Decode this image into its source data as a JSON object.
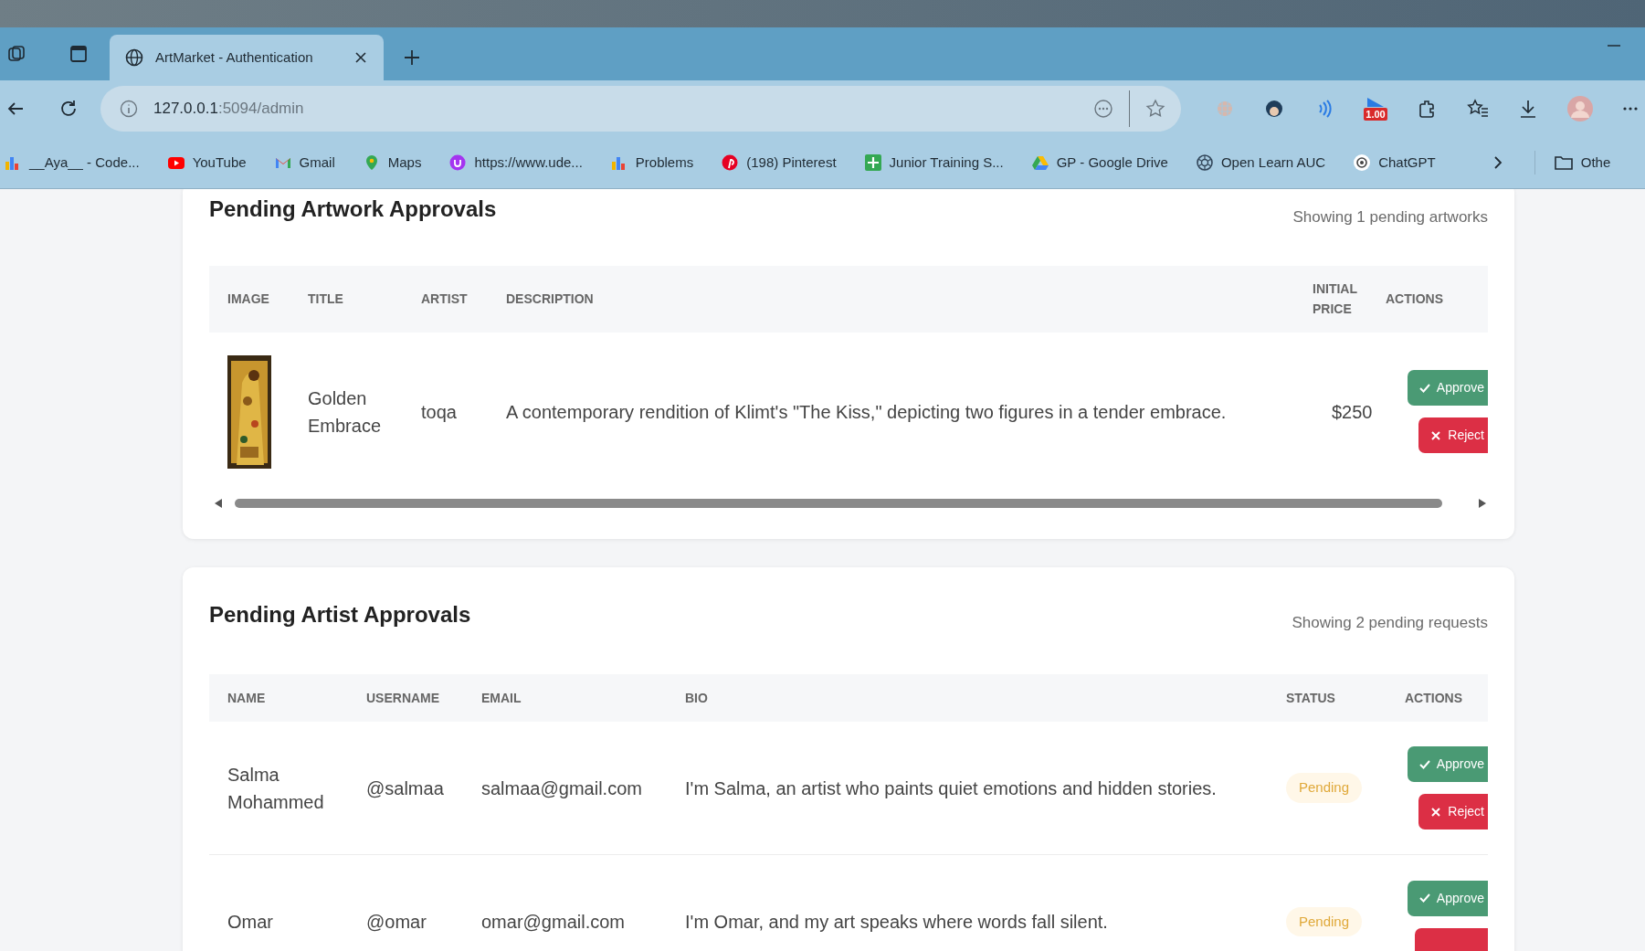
{
  "browser": {
    "tab": {
      "title": "ArtMarket - Authentication",
      "selected": true
    },
    "address": {
      "host": "127.0.0.1",
      "path": ":5094/admin"
    },
    "extension_badge": "1.00",
    "bookmarks": [
      {
        "label": "__Aya__ - Code...",
        "kind": "chart"
      },
      {
        "label": "YouTube",
        "kind": "youtube"
      },
      {
        "label": "Gmail",
        "kind": "mail"
      },
      {
        "label": "Maps",
        "kind": "pin"
      },
      {
        "label": "https://www.ude...",
        "kind": "udemy"
      },
      {
        "label": "Problems",
        "kind": "chart"
      },
      {
        "label": "(198) Pinterest",
        "kind": "pinterest"
      },
      {
        "label": "Junior Training S...",
        "kind": "sheet"
      },
      {
        "label": "GP - Google Drive",
        "kind": "drive"
      },
      {
        "label": "Open Learn AUC",
        "kind": "aperture"
      },
      {
        "label": "ChatGPT",
        "kind": "chatgpt"
      }
    ],
    "other_bookmarks": "Othe"
  },
  "artworks": {
    "title": "Pending Artwork Approvals",
    "summary": "Showing 1 pending artworks",
    "columns": [
      "IMAGE",
      "TITLE",
      "ARTIST",
      "DESCRIPTION",
      "INITIAL PRICE",
      "ACTIONS"
    ],
    "rows": [
      {
        "title": "Golden Embrace",
        "artist": "toqa",
        "description": "A contemporary rendition of Klimt's \"The Kiss,\" depicting two figures in a tender embrace.",
        "price": "$250",
        "approve": "Approve",
        "reject": "Reject"
      }
    ]
  },
  "artists": {
    "title": "Pending Artist Approvals",
    "summary": "Showing 2 pending requests",
    "columns": [
      "NAME",
      "USERNAME",
      "EMAIL",
      "BIO",
      "STATUS",
      "ACTIONS"
    ],
    "rows": [
      {
        "name": "Salma Mohammed",
        "username": "@salmaa",
        "email": "salmaa@gmail.com",
        "bio": "I'm Salma, an artist who paints quiet emotions and hidden stories.",
        "status": "Pending",
        "approve": "Approve",
        "reject": "Reject"
      },
      {
        "name": "Omar",
        "username": "@omar",
        "email": "omar@gmail.com",
        "bio": "I'm Omar, and my art speaks where words fall silent.",
        "status": "Pending",
        "approve": "Approve"
      }
    ]
  }
}
